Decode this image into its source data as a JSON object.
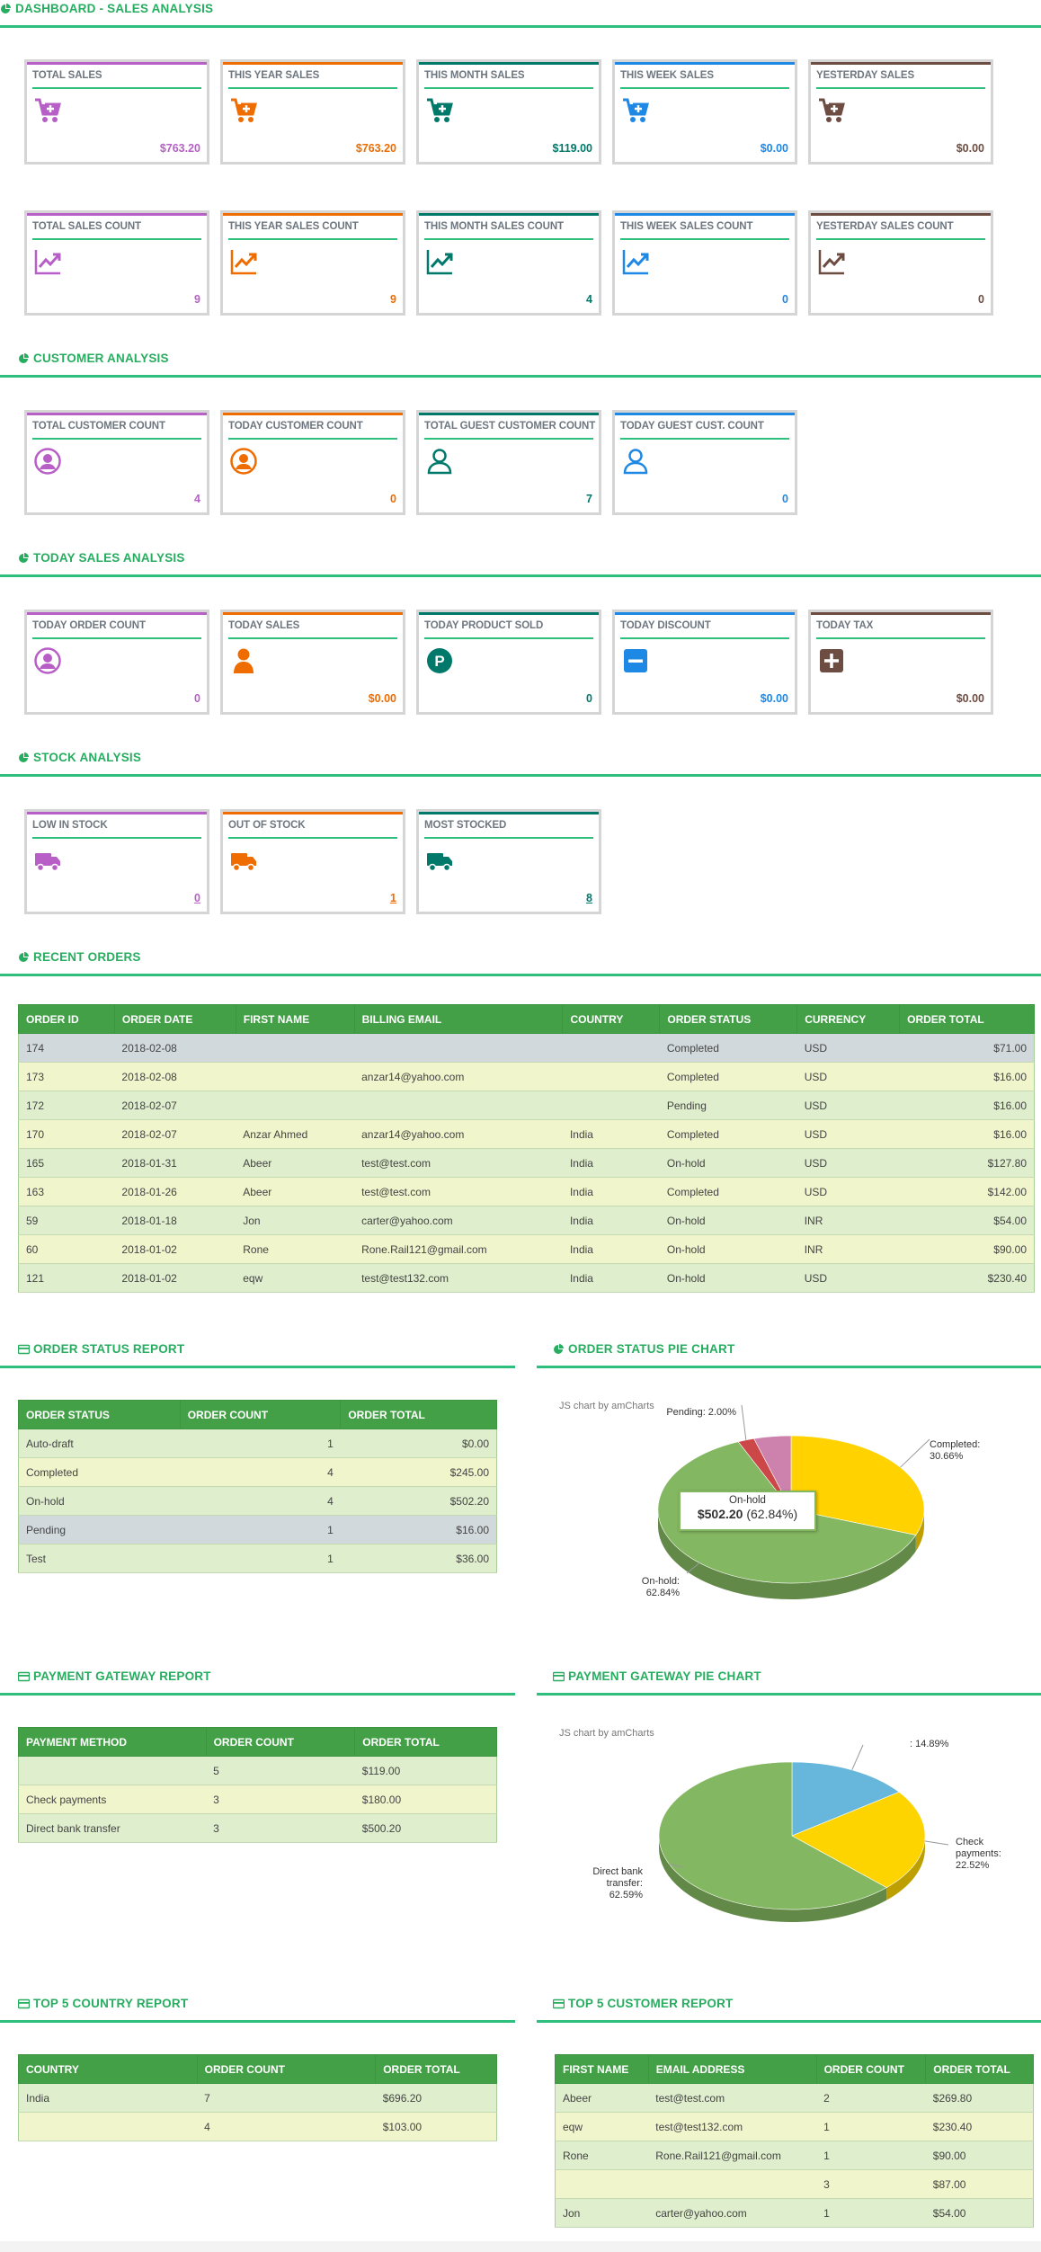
{
  "sections": {
    "sales_analysis": "DASHBOARD - SALES ANALYSIS",
    "customer_analysis": "CUSTOMER ANALYSIS",
    "today_sales_analysis": "TODAY SALES ANALYSIS",
    "stock_analysis": "STOCK ANALYSIS",
    "recent_orders": "RECENT ORDERS",
    "order_status_report": "ORDER STATUS REPORT",
    "order_status_pie": "ORDER STATUS PIE CHART",
    "payment_gateway_report": "PAYMENT GATEWAY REPORT",
    "payment_gateway_pie": "PAYMENT GATEWAY PIE CHART",
    "top5_country": "TOP 5 COUNTRY REPORT",
    "top5_customer": "TOP 5 CUSTOMER REPORT"
  },
  "colors": {
    "purple": "#b75fc7",
    "orange": "#ef6c00",
    "teal": "#00796b",
    "blue": "#1e88e5",
    "brown": "#6d4c41",
    "green": "#27ad60"
  },
  "sales_cards": [
    {
      "title": "TOTAL SALES",
      "value": "$763.20",
      "icon": "cart-plus-icon",
      "color": "purple"
    },
    {
      "title": "THIS YEAR SALES",
      "value": "$763.20",
      "icon": "cart-plus-icon",
      "color": "orange"
    },
    {
      "title": "THIS MONTH SALES",
      "value": "$119.00",
      "icon": "cart-plus-icon",
      "color": "teal"
    },
    {
      "title": "THIS WEEK SALES",
      "value": "$0.00",
      "icon": "cart-plus-icon",
      "color": "blue"
    },
    {
      "title": "YESTERDAY SALES",
      "value": "$0.00",
      "icon": "cart-plus-icon",
      "color": "brown"
    }
  ],
  "count_cards": [
    {
      "title": "TOTAL SALES COUNT",
      "value": "9",
      "icon": "trend-chart-icon",
      "color": "purple"
    },
    {
      "title": "THIS YEAR SALES COUNT",
      "value": "9",
      "icon": "trend-chart-icon",
      "color": "orange"
    },
    {
      "title": "THIS MONTH SALES COUNT",
      "value": "4",
      "icon": "trend-chart-icon",
      "color": "teal"
    },
    {
      "title": "THIS WEEK SALES COUNT",
      "value": "0",
      "icon": "trend-chart-icon",
      "color": "blue"
    },
    {
      "title": "YESTERDAY SALES COUNT",
      "value": "0",
      "icon": "trend-chart-icon",
      "color": "brown"
    }
  ],
  "customer_cards": [
    {
      "title": "TOTAL CUSTOMER COUNT",
      "value": "4",
      "icon": "user-circle-icon",
      "color": "purple"
    },
    {
      "title": "TODAY CUSTOMER COUNT",
      "value": "0",
      "icon": "user-circle-icon",
      "color": "orange"
    },
    {
      "title": "TOTAL GUEST CUSTOMER COUNT",
      "value": "7",
      "icon": "user-outline-icon",
      "color": "teal"
    },
    {
      "title": "TODAY GUEST CUST. COUNT",
      "value": "0",
      "icon": "user-outline-icon",
      "color": "blue"
    }
  ],
  "today_cards": [
    {
      "title": "TODAY ORDER COUNT",
      "value": "0",
      "icon": "user-circle-icon",
      "color": "purple"
    },
    {
      "title": "TODAY SALES",
      "value": "$0.00",
      "icon": "user-solid-icon",
      "color": "orange"
    },
    {
      "title": "TODAY PRODUCT SOLD",
      "value": "0",
      "icon": "p-circle-icon",
      "color": "teal"
    },
    {
      "title": "TODAY DISCOUNT",
      "value": "$0.00",
      "icon": "minus-square-icon",
      "color": "blue"
    },
    {
      "title": "TODAY TAX",
      "value": "$0.00",
      "icon": "plus-square-icon",
      "color": "brown"
    }
  ],
  "stock_cards": [
    {
      "title": "LOW IN STOCK",
      "value": "0",
      "icon": "truck-icon",
      "color": "purple"
    },
    {
      "title": "OUT OF STOCK",
      "value": "1",
      "icon": "truck-icon",
      "color": "orange"
    },
    {
      "title": "MOST STOCKED",
      "value": "8",
      "icon": "truck-icon",
      "color": "teal"
    }
  ],
  "recent_orders": {
    "headers": [
      "ORDER ID",
      "ORDER DATE",
      "FIRST NAME",
      "BILLING EMAIL",
      "COUNTRY",
      "ORDER STATUS",
      "CURRENCY",
      "ORDER TOTAL"
    ],
    "rows": [
      [
        "174",
        "2018-02-08",
        "",
        "",
        "",
        "Completed",
        "USD",
        "$71.00"
      ],
      [
        "173",
        "2018-02-08",
        "",
        "anzar14@yahoo.com",
        "",
        "Completed",
        "USD",
        "$16.00"
      ],
      [
        "172",
        "2018-02-07",
        "",
        "",
        "",
        "Pending",
        "USD",
        "$16.00"
      ],
      [
        "170",
        "2018-02-07",
        "Anzar Ahmed",
        "anzar14@yahoo.com",
        "India",
        "Completed",
        "USD",
        "$16.00"
      ],
      [
        "165",
        "2018-01-31",
        "Abeer",
        "test@test.com",
        "India",
        "On-hold",
        "USD",
        "$127.80"
      ],
      [
        "163",
        "2018-01-26",
        "Abeer",
        "test@test.com",
        "India",
        "Completed",
        "USD",
        "$142.00"
      ],
      [
        "59",
        "2018-01-18",
        "Jon",
        "carter@yahoo.com",
        "India",
        "On-hold",
        "INR",
        "$54.00"
      ],
      [
        "60",
        "2018-01-02",
        "Rone",
        "Rone.Rail121@gmail.com",
        "India",
        "On-hold",
        "INR",
        "$90.00"
      ],
      [
        "121",
        "2018-01-02",
        "eqw",
        "test@test132.com",
        "India",
        "On-hold",
        "USD",
        "$230.40"
      ]
    ]
  },
  "order_status_report": {
    "headers": [
      "ORDER STATUS",
      "ORDER COUNT",
      "ORDER TOTAL"
    ],
    "rows": [
      [
        "Auto-draft",
        "1",
        "$0.00"
      ],
      [
        "Completed",
        "4",
        "$245.00"
      ],
      [
        "On-hold",
        "4",
        "$502.20"
      ],
      [
        "Pending",
        "1",
        "$16.00"
      ],
      [
        "Test",
        "1",
        "$36.00"
      ]
    ]
  },
  "payment_gateway_report": {
    "headers": [
      "PAYMENT METHOD",
      "ORDER COUNT",
      "ORDER TOTAL"
    ],
    "rows": [
      [
        "",
        "5",
        "$119.00"
      ],
      [
        "Check payments",
        "3",
        "$180.00"
      ],
      [
        "Direct bank transfer",
        "3",
        "$500.20"
      ]
    ]
  },
  "top5_country": {
    "headers": [
      "COUNTRY",
      "ORDER COUNT",
      "ORDER TOTAL"
    ],
    "rows": [
      [
        "India",
        "7",
        "$696.20"
      ],
      [
        "",
        "4",
        "$103.00"
      ]
    ]
  },
  "top5_customer": {
    "headers": [
      "FIRST NAME",
      "EMAIL ADDRESS",
      "ORDER COUNT",
      "ORDER TOTAL"
    ],
    "rows": [
      [
        "Abeer",
        "test@test.com",
        "2",
        "$269.80"
      ],
      [
        "eqw",
        "test@test132.com",
        "1",
        "$230.40"
      ],
      [
        "Rone",
        "Rone.Rail121@gmail.com",
        "1",
        "$90.00"
      ],
      [
        "",
        "",
        "3",
        "$87.00"
      ],
      [
        "Jon",
        "carter@yahoo.com",
        "1",
        "$54.00"
      ]
    ]
  },
  "chart_data": [
    {
      "type": "pie",
      "credit": "JS chart by amCharts",
      "slices": [
        {
          "name": "Completed",
          "percent": 30.66,
          "label": "Completed:\n30.66%",
          "color": "#ffd200"
        },
        {
          "name": "On-hold",
          "percent": 62.84,
          "label": "On-hold:\n62.84%",
          "color": "#84b761"
        },
        {
          "name": "Pending",
          "percent": 2.0,
          "label": "Pending: 2.00%",
          "color": "#cc4748"
        },
        {
          "name": "Test",
          "percent": 4.5,
          "label": "",
          "color": "#cd82ad"
        }
      ],
      "tooltip": {
        "title": "On-hold",
        "value": "$502.20",
        "percent": "(62.84%)"
      }
    },
    {
      "type": "pie",
      "credit": "JS chart by amCharts",
      "slices": [
        {
          "name": "",
          "percent": 14.89,
          "label": ": 14.89%",
          "color": "#67b7dc"
        },
        {
          "name": "Check payments",
          "percent": 22.52,
          "label": "Check\npayments:\n22.52%",
          "color": "#fdd400"
        },
        {
          "name": "Direct bank transfer",
          "percent": 62.59,
          "label": "Direct bank\ntransfer:\n62.59%",
          "color": "#84b761"
        }
      ]
    }
  ]
}
